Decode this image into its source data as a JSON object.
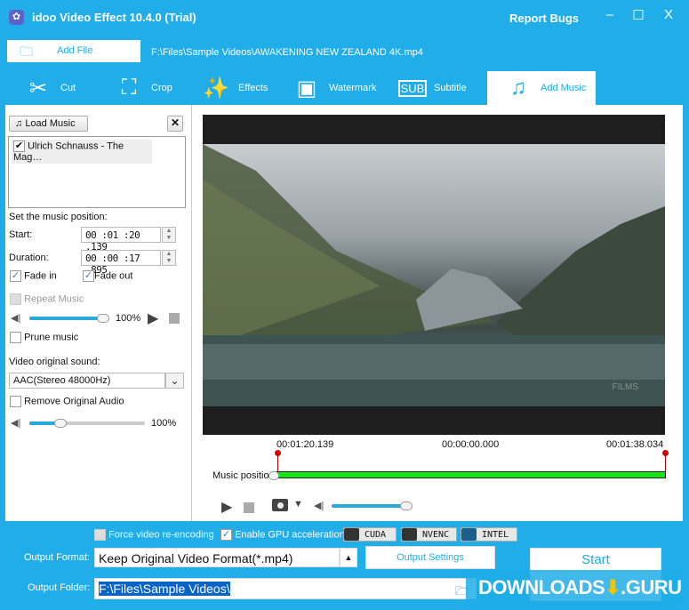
{
  "window": {
    "title": "idoo Video Effect 10.4.0 (Trial)",
    "report_bugs": "Report Bugs",
    "minimize": "–",
    "maximize": "☐",
    "close": "X"
  },
  "toolbar": {
    "add_file": "Add File",
    "file_path": "F:\\Files\\Sample Videos\\AWAKENING  NEW ZEALAND 4K.mp4"
  },
  "tabs": [
    {
      "label": "Cut",
      "icon": "✂"
    },
    {
      "label": "Crop",
      "icon": "⛶"
    },
    {
      "label": "Effects",
      "icon": "✨"
    },
    {
      "label": "Watermark",
      "icon": "▣"
    },
    {
      "label": "Subtitle",
      "icon": "SUB"
    },
    {
      "label": "Add Music",
      "icon": "♫"
    }
  ],
  "music": {
    "load_label": "Load Music",
    "remove": "✕",
    "track": "Ulrich Schnauss - The Mag…",
    "position_heading": "Set the music position:",
    "start_label": "Start:",
    "start_value": "00 :01 :20 .139",
    "duration_label": "Duration:",
    "duration_value": "00 :00 :17 .895",
    "fade_in": "Fade in",
    "fade_out": "Fade out",
    "repeat": "Repeat Music",
    "volume": "100%",
    "volume_fraction": 1.0,
    "prune": "Prune music"
  },
  "original": {
    "heading": "Video original sound:",
    "audio_track": "AAC(Stereo 48000Hz)",
    "remove_label": "Remove Original Audio",
    "volume": "100%",
    "volume_fraction": 0.2
  },
  "timeline": {
    "start": "00:01:20.139",
    "current": "00:00:00.000",
    "end": "00:01:38.034",
    "music_position_label": "Music position",
    "player_volume_fraction": 0.9,
    "watermark": "FILMS"
  },
  "bottom": {
    "force_reencode": "Force video re-encoding",
    "gpu_accel": "Enable GPU acceleration",
    "gpus": [
      "CUDA",
      "NVENC",
      "INTEL"
    ],
    "output_format_label": "Output Format:",
    "output_format": "Keep Original Video Format(*.mp4)",
    "output_settings": "Output Settings",
    "output_folder_label": "Output Folder:",
    "output_folder": "F:\\Files\\Sample Videos\\",
    "start": "Start",
    "watermark": "DOWNLOADS",
    "watermark2": ".GURU"
  }
}
